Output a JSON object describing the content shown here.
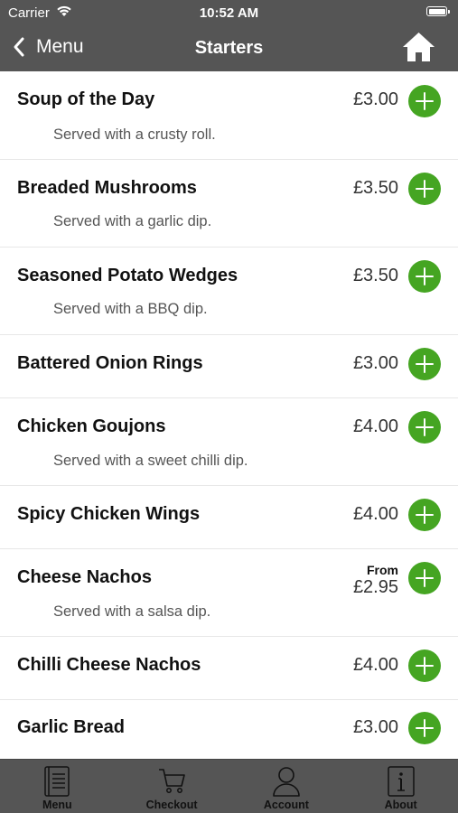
{
  "status_bar": {
    "carrier": "Carrier",
    "time": "10:52 AM"
  },
  "nav": {
    "back_label": "Menu",
    "title": "Starters"
  },
  "colors": {
    "header": "#555555",
    "accent_green": "#45a522",
    "tab_bar": "#555555"
  },
  "items": [
    {
      "name": "Soup of the Day",
      "price": "£3.00",
      "desc": "Served with a crusty roll."
    },
    {
      "name": "Breaded Mushrooms",
      "price": "£3.50",
      "desc": "Served with a garlic dip."
    },
    {
      "name": "Seasoned Potato Wedges",
      "price": "£3.50",
      "desc": "Served with a BBQ dip."
    },
    {
      "name": "Battered Onion Rings",
      "price": "£3.00"
    },
    {
      "name": "Chicken Goujons",
      "price": "£4.00",
      "desc": "Served with a sweet chilli dip."
    },
    {
      "name": "Spicy Chicken Wings",
      "price": "£4.00"
    },
    {
      "name": "Cheese Nachos",
      "price_from": "From",
      "price": "£2.95",
      "desc": "Served with a salsa dip."
    },
    {
      "name": "Chilli Cheese Nachos",
      "price": "£4.00"
    },
    {
      "name": "Garlic Bread",
      "price": "£3.00"
    }
  ],
  "tabs": [
    {
      "label": "Menu",
      "icon": "menu-book-icon"
    },
    {
      "label": "Checkout",
      "icon": "cart-icon"
    },
    {
      "label": "Account",
      "icon": "person-icon"
    },
    {
      "label": "About",
      "icon": "info-icon"
    }
  ]
}
